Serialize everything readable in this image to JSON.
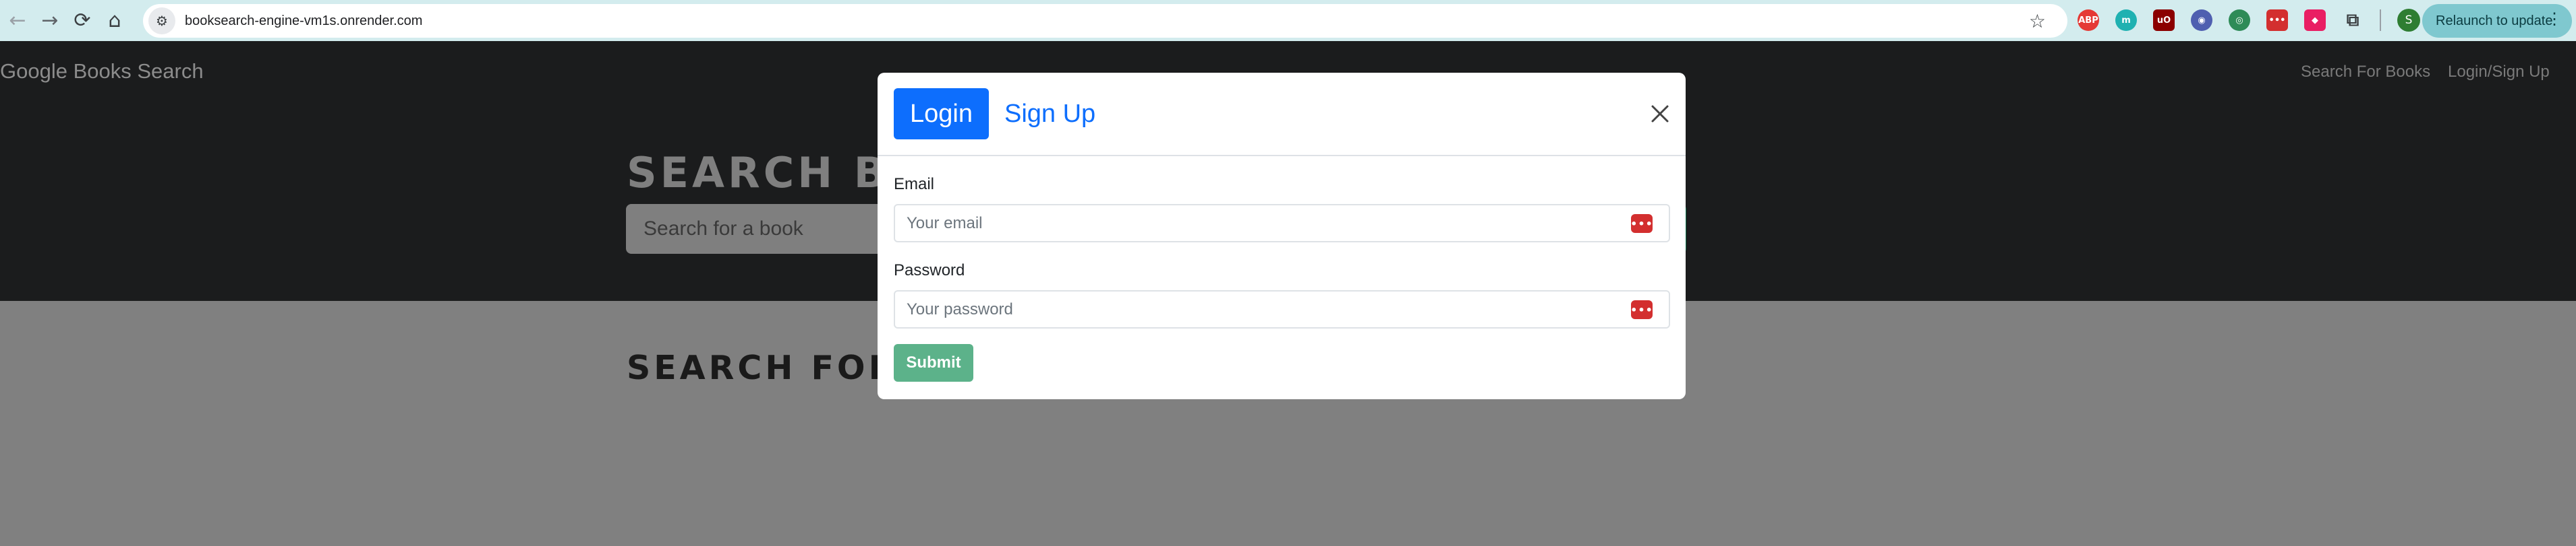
{
  "browser": {
    "url": "booksearch-engine-vm1s.onrender.com",
    "relaunch_label": "Relaunch to update",
    "profile_initial": "S",
    "extensions": [
      {
        "name": "adblock-plus-extension",
        "label": "ABP",
        "color": "#e53935"
      },
      {
        "name": "teal-m-extension",
        "label": "m",
        "color": "#1fb1b1"
      },
      {
        "name": "ublock-extension",
        "label": "uO",
        "color": "#8b0000"
      },
      {
        "name": "globe-extension",
        "label": "◉",
        "color": "#4f5fb0"
      },
      {
        "name": "chrome-extension",
        "label": "◎",
        "color": "#2e8b57"
      },
      {
        "name": "password-manager-extension",
        "label": "•••",
        "color": "#d32f2f"
      },
      {
        "name": "pink-extension",
        "label": "◆",
        "color": "#e91e63"
      }
    ]
  },
  "site": {
    "brand": "Google Books Search",
    "nav": {
      "search_link": "Search For Books",
      "login_link": "Login/Sign Up"
    },
    "hero_title": "SEARCH B",
    "search_placeholder": "Search for a book",
    "section_title": "SEARCH FOR"
  },
  "modal": {
    "tabs": {
      "login": "Login",
      "signup": "Sign Up"
    },
    "email_label": "Email",
    "email_placeholder": "Your email",
    "password_label": "Password",
    "password_placeholder": "Your password",
    "password_icon_text": "•••",
    "submit_label": "Submit"
  },
  "colors": {
    "primary": "#0d6efd",
    "submit": "#5cb28a",
    "chrome_bar": "#d3ecee"
  }
}
